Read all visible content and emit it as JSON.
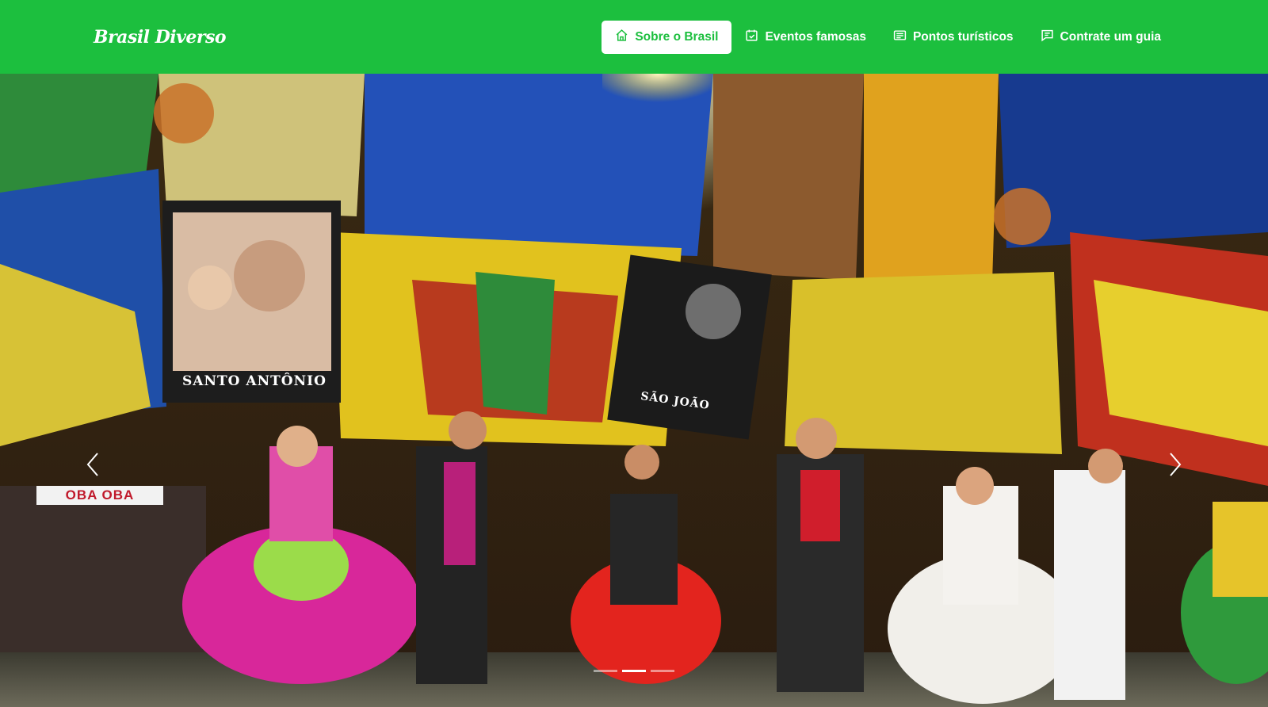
{
  "brand": "Brasil Diverso",
  "nav": {
    "items": [
      {
        "label": "Sobre o Brasil",
        "icon": "home-icon",
        "active": true
      },
      {
        "label": "Eventos famosas",
        "icon": "calendar-check-icon",
        "active": false
      },
      {
        "label": "Pontos turísticos",
        "icon": "list-card-icon",
        "active": false
      },
      {
        "label": "Contrate um guia",
        "icon": "chat-icon",
        "active": false
      }
    ]
  },
  "hero": {
    "image": "festa-junina-dancers-photo",
    "banner_left": "SANTO ANTÔNIO",
    "banner_right": "SÃO JOÃO",
    "sign": "OBA OBA"
  },
  "carousel": {
    "prev_icon": "chevron-left-icon",
    "next_icon": "chevron-right-icon",
    "slides_count": 3,
    "active_slide": 2
  },
  "colors": {
    "navbar": "#1cbf3e",
    "nav_text": "#ffffff"
  }
}
